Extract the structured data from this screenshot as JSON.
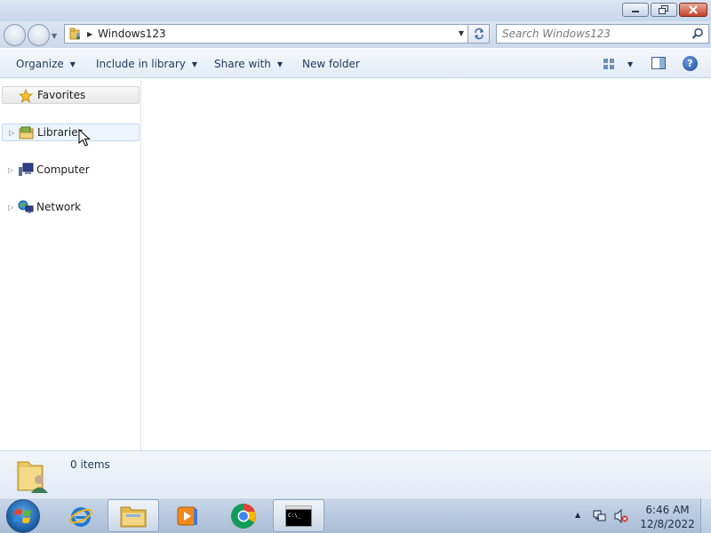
{
  "window": {
    "controls": {
      "minimize": "minimize",
      "maximize": "restore",
      "close": "close"
    }
  },
  "address": {
    "path": "Windows123",
    "search_placeholder": "Search Windows123"
  },
  "toolbar": {
    "organize": "Organize",
    "include_in_library": "Include in library",
    "share_with": "Share with",
    "new_folder": "New folder",
    "help": "?"
  },
  "nav_pane": {
    "items": [
      {
        "label": "Favorites",
        "icon": "star-icon"
      },
      {
        "label": "Libraries",
        "icon": "libraries-icon"
      },
      {
        "label": "Computer",
        "icon": "computer-icon"
      },
      {
        "label": "Network",
        "icon": "network-icon"
      }
    ]
  },
  "details": {
    "item_count": "0 items"
  },
  "taskbar": {
    "apps": [
      {
        "name": "Internet Explorer",
        "icon": "ie-icon"
      },
      {
        "name": "Windows Explorer",
        "icon": "folder-icon",
        "active": true
      },
      {
        "name": "Windows Media Player",
        "icon": "media-player-icon"
      },
      {
        "name": "Google Chrome",
        "icon": "chrome-icon"
      },
      {
        "name": "Command Prompt",
        "icon": "cmd-icon"
      }
    ],
    "clock": {
      "time": "6:46 AM",
      "date": "12/8/2022"
    }
  },
  "colors": {
    "toolbar_text": "#1e395b",
    "taskbar": "#a9bdd6",
    "selection": "#edf4fc"
  }
}
